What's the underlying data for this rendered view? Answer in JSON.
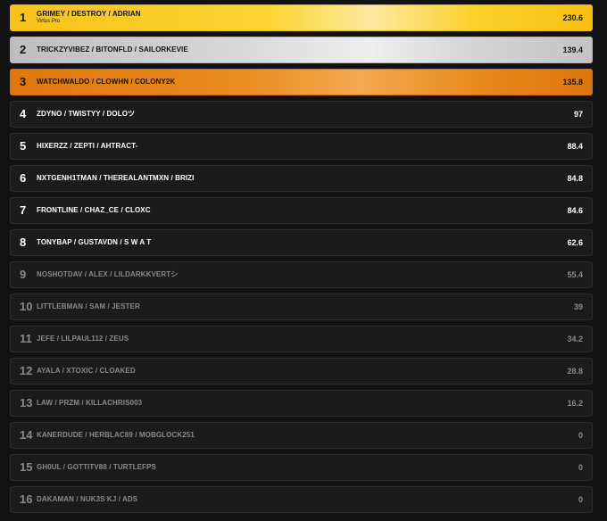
{
  "rows": [
    {
      "rank": "1",
      "names": "GRIMEY / DESTROY / ADRIAN",
      "team": "Virtus Pro",
      "score": "230.6"
    },
    {
      "rank": "2",
      "names": "TRICKZYVIBEZ / BITONFLD / SAILORKEVIE",
      "score": "139.4"
    },
    {
      "rank": "3",
      "names": "WATCHWALDO / CLOWHN / COLONY2K",
      "score": "135.8"
    },
    {
      "rank": "4",
      "names": "ZDYNO / TWISTYY / DOLOツ",
      "score": "97"
    },
    {
      "rank": "5",
      "names": "HIXERZZ / ZEPTI / AHTRACT-",
      "score": "88.4"
    },
    {
      "rank": "6",
      "names": "NXTGENH1TMAN / THEREALANTMXN / BRIZI",
      "score": "84.8"
    },
    {
      "rank": "7",
      "names": "FRONTLINE / CHAZ_CE / CLOXC",
      "score": "84.6"
    },
    {
      "rank": "8",
      "names": "TONYBAP / GUSTAVDN / S W A T",
      "score": "62.6"
    },
    {
      "rank": "9",
      "names": "NOSHOTDAV / ALEX / LILDARKKVERTシ",
      "score": "55.4"
    },
    {
      "rank": "10",
      "names": "LITTLEBMAN / SAM / JESTER",
      "score": "39"
    },
    {
      "rank": "11",
      "names": "JEFE / LILPAUL112 / ZEUS",
      "score": "34.2"
    },
    {
      "rank": "12",
      "names": "AYALA / XTOXIC / CLOAKED",
      "score": "28.8"
    },
    {
      "rank": "13",
      "names": "LAW / PRZM / KILLACHRIS003",
      "score": "16.2"
    },
    {
      "rank": "14",
      "names": "KANERDUDE / HERBLAC89 / MOBGLOCK251",
      "score": "0"
    },
    {
      "rank": "15",
      "names": "GH0UL / GOTTITV88 / TURTLEFPS",
      "score": "0"
    },
    {
      "rank": "16",
      "names": "DAKAMAN / NUK3S KJ / ADS",
      "score": "0"
    }
  ],
  "colors": {
    "background": "#121212",
    "row": "#1b1b1b",
    "gold": "#fcd535",
    "silver": "#d9d9d9",
    "bronze": "#ea8c1e",
    "text_bright": "#ffffff",
    "text_dim": "#8a8a8a"
  }
}
